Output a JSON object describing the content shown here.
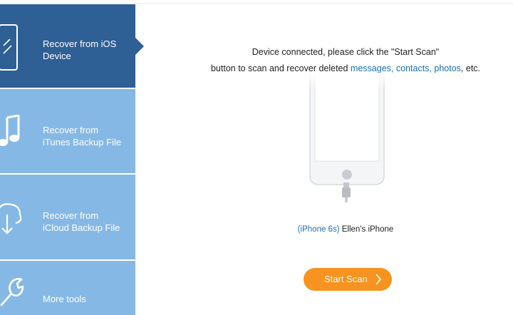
{
  "sidebar": {
    "items": [
      {
        "label": "Recover from iOS Device",
        "line1": "Recover from iOS",
        "line2": "Device",
        "icon": "phone-icon",
        "active": true
      },
      {
        "label": "Recover from iTunes Backup File",
        "line1": "Recover from",
        "line2": "iTunes Backup File",
        "icon": "music-note-icon",
        "active": false
      },
      {
        "label": "Recover from iCloud Backup File",
        "line1": "Recover from",
        "line2": "iCloud Backup File",
        "icon": "cloud-download-icon",
        "active": false
      },
      {
        "label": "More tools",
        "line1": "More tools",
        "icon": "wrench-icon",
        "active": false
      }
    ]
  },
  "main": {
    "message": {
      "line1": "Device connected, please click the \"Start Scan\"",
      "line2_prefix": "button to scan and recover deleted ",
      "link_messages": "messages,",
      "link_contacts": "contacts,",
      "link_photos": "photos",
      "line2_suffix": ", etc."
    },
    "device": {
      "model": "(iPhone 6s)",
      "name": "Ellen's iPhone"
    },
    "start_button": "Start Scan"
  },
  "colors": {
    "active_nav": "#2e5f95",
    "inactive_nav": "#86b8e6",
    "link": "#1a6fb5",
    "button": "#f7931e"
  }
}
